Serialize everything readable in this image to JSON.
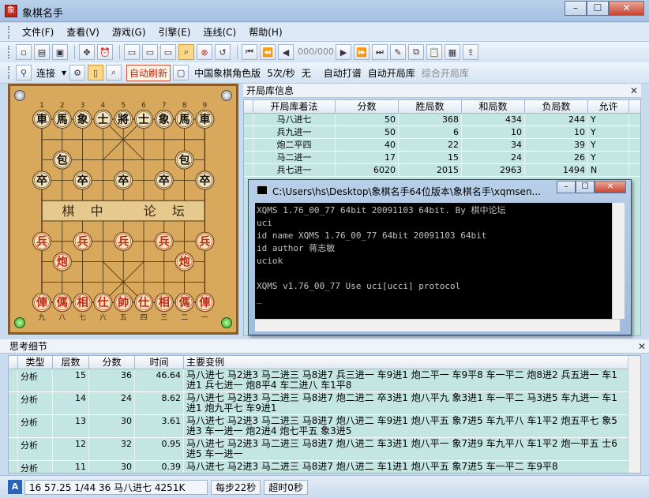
{
  "window": {
    "title": "象棋名手"
  },
  "menu": [
    "文件(F)",
    "查看(V)",
    "游戏(G)",
    "引擎(E)",
    "连线(C)",
    "帮助(H)"
  ],
  "toolbar1": {
    "counter": "000/000"
  },
  "toolbar2": {
    "connect": "连接",
    "refresh": "自动刷新",
    "edition": "中国象棋角色版",
    "rate": "5次/秒",
    "none": "无",
    "auto_play": "自动打谱",
    "auto_open": "自动开局库",
    "combined": "综合开局库"
  },
  "board": {
    "file_numbers_top": [
      "1",
      "2",
      "3",
      "4",
      "5",
      "6",
      "7",
      "8",
      "9"
    ],
    "file_numbers_bottom": [
      "九",
      "八",
      "七",
      "六",
      "五",
      "四",
      "三",
      "二",
      "一"
    ],
    "river_text": [
      "棋",
      "中",
      "论",
      "坛"
    ],
    "pieces": [
      {
        "f": 0,
        "r": 0,
        "t": "車",
        "side": "black"
      },
      {
        "f": 1,
        "r": 0,
        "t": "馬",
        "side": "black"
      },
      {
        "f": 2,
        "r": 0,
        "t": "象",
        "side": "black"
      },
      {
        "f": 3,
        "r": 0,
        "t": "士",
        "side": "black"
      },
      {
        "f": 4,
        "r": 0,
        "t": "將",
        "side": "black"
      },
      {
        "f": 5,
        "r": 0,
        "t": "士",
        "side": "black"
      },
      {
        "f": 6,
        "r": 0,
        "t": "象",
        "side": "black"
      },
      {
        "f": 7,
        "r": 0,
        "t": "馬",
        "side": "black"
      },
      {
        "f": 8,
        "r": 0,
        "t": "車",
        "side": "black"
      },
      {
        "f": 1,
        "r": 2,
        "t": "包",
        "side": "black"
      },
      {
        "f": 7,
        "r": 2,
        "t": "包",
        "side": "black"
      },
      {
        "f": 0,
        "r": 3,
        "t": "卒",
        "side": "black"
      },
      {
        "f": 2,
        "r": 3,
        "t": "卒",
        "side": "black"
      },
      {
        "f": 4,
        "r": 3,
        "t": "卒",
        "side": "black"
      },
      {
        "f": 6,
        "r": 3,
        "t": "卒",
        "side": "black"
      },
      {
        "f": 8,
        "r": 3,
        "t": "卒",
        "side": "black"
      },
      {
        "f": 0,
        "r": 6,
        "t": "兵",
        "side": "red"
      },
      {
        "f": 2,
        "r": 6,
        "t": "兵",
        "side": "red"
      },
      {
        "f": 4,
        "r": 6,
        "t": "兵",
        "side": "red"
      },
      {
        "f": 6,
        "r": 6,
        "t": "兵",
        "side": "red"
      },
      {
        "f": 8,
        "r": 6,
        "t": "兵",
        "side": "red"
      },
      {
        "f": 1,
        "r": 7,
        "t": "炮",
        "side": "red"
      },
      {
        "f": 7,
        "r": 7,
        "t": "炮",
        "side": "red"
      },
      {
        "f": 0,
        "r": 9,
        "t": "俥",
        "side": "red"
      },
      {
        "f": 1,
        "r": 9,
        "t": "傌",
        "side": "red"
      },
      {
        "f": 2,
        "r": 9,
        "t": "相",
        "side": "red"
      },
      {
        "f": 3,
        "r": 9,
        "t": "仕",
        "side": "red"
      },
      {
        "f": 4,
        "r": 9,
        "t": "帥",
        "side": "red"
      },
      {
        "f": 5,
        "r": 9,
        "t": "仕",
        "side": "red"
      },
      {
        "f": 6,
        "r": 9,
        "t": "相",
        "side": "red"
      },
      {
        "f": 7,
        "r": 9,
        "t": "傌",
        "side": "red"
      },
      {
        "f": 8,
        "r": 9,
        "t": "俥",
        "side": "red"
      }
    ]
  },
  "opening_book": {
    "title": "开局库信息",
    "headers": [
      "开局库着法",
      "分数",
      "胜局数",
      "和局数",
      "负局数",
      "允许"
    ],
    "rows": [
      [
        "马八进七",
        "50",
        "368",
        "434",
        "244",
        "Y"
      ],
      [
        "兵九进一",
        "50",
        "6",
        "10",
        "10",
        "Y"
      ],
      [
        "炮二平四",
        "40",
        "22",
        "34",
        "39",
        "Y"
      ],
      [
        "马二进一",
        "17",
        "15",
        "24",
        "26",
        "Y"
      ],
      [
        "兵七进一",
        "6020",
        "2015",
        "2963",
        "1494",
        "N"
      ]
    ]
  },
  "console": {
    "title": "C:\\Users\\hs\\Desktop\\象棋名手64位版本\\象棋名手\\xqmsen...",
    "lines": [
      "XQMS 1.76_00_77 64bit 20091103 64bit. By 棋中论坛",
      "uci",
      "id name XQMS 1.76_00_77 64bit 20091103 64bit",
      "id author 蒋志敏",
      "uciok",
      "",
      "XQMS v1.76_00_77 Use uci[ucci] protocol",
      "_"
    ]
  },
  "analysis": {
    "title": "思考细节",
    "headers": [
      "类型",
      "层数",
      "分数",
      "时间",
      "主要变例"
    ],
    "rows": [
      [
        "分析",
        "15",
        "36",
        "46.64",
        "马八进七 马2进3 马二进三 马8进7 兵三进一 车9进1 炮二平一 车9平8 车一平二 炮8进2 兵五进一 车1进1 兵七进一 炮8平4 车二进八 车1平8"
      ],
      [
        "分析",
        "14",
        "24",
        "8.62",
        "马八进七 马2进3 马二进三 马8进7 炮二进二 卒3进1 炮八平九 象3进1 车一平二 马3进5 车九进一 车1进1 炮九平七 车9进1"
      ],
      [
        "分析",
        "13",
        "30",
        "3.61",
        "马八进七 马2进3 马二进三 马8进7 炮八进二 车9进1 炮八平五 象7进5 车九平八 车1平2 炮五平七 象5进3 车一进一 炮2进4 炮七平五 象3进5"
      ],
      [
        "分析",
        "12",
        "32",
        "0.95",
        "马八进七 马2进3 马二进三 马8进7 炮八进二 车3进1 炮八平一 象7进9 车九平八 车1平2 炮一平五 士6进5 车一进一"
      ],
      [
        "分析",
        "11",
        "30",
        "0.39",
        "马八进七 马2进3 马二进三 马8进7 炮八进二 车1进1 炮八平五 象7进5 车一平二 车9平8"
      ]
    ]
  },
  "status": {
    "info": "16 57.25 1/44 36 马八进七 4251K",
    "per_step": "每步22秒",
    "timeout": "超时0秒",
    "badge": "A"
  }
}
